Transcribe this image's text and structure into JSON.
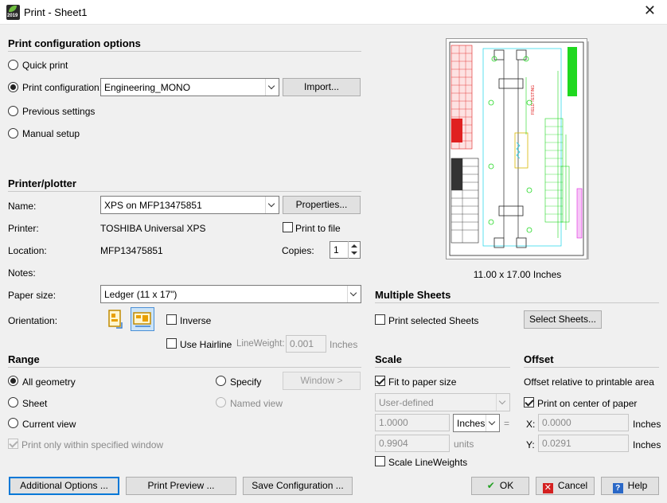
{
  "window": {
    "title": "Print - Sheet1",
    "app_icon_year": "2019"
  },
  "print_config": {
    "heading": "Print configuration options",
    "quick_print": "Quick print",
    "print_configuration": "Print configuration:",
    "config_value": "Engineering_MONO",
    "import_button": "Import...",
    "previous_settings": "Previous settings",
    "manual_setup": "Manual setup"
  },
  "printer": {
    "heading": "Printer/plotter",
    "name_label": "Name:",
    "name_value": "XPS on MFP13475851",
    "properties_button": "Properties...",
    "printer_label": "Printer:",
    "printer_value": "TOSHIBA Universal XPS",
    "print_to_file": "Print to file",
    "location_label": "Location:",
    "location_value": "MFP13475851",
    "copies_label": "Copies:",
    "copies_value": "1",
    "notes_label": "Notes:",
    "paper_size_label": "Paper size:",
    "paper_size_value": "Ledger (11 x 17\")",
    "orientation_label": "Orientation:",
    "inverse": "Inverse",
    "use_hairline": "Use Hairline",
    "lineweight_label": "LineWeight:",
    "lineweight_value": "0.001",
    "lineweight_unit": "Inches"
  },
  "preview": {
    "caption": "11.00 x 17.00 Inches"
  },
  "multiple_sheets": {
    "heading": "Multiple Sheets",
    "print_selected": "Print selected Sheets",
    "select_button": "Select Sheets..."
  },
  "range": {
    "heading": "Range",
    "all_geometry": "All geometry",
    "specify": "Specify",
    "window_button": "Window >",
    "sheet": "Sheet",
    "named_view": "Named view",
    "current_view": "Current view",
    "print_only_window": "Print only within specified window"
  },
  "scale": {
    "heading": "Scale",
    "fit_to_paper": "Fit to paper size",
    "scale_value": "User-defined",
    "value1": "1.0000",
    "unit_value": "Inches",
    "equals": "=",
    "value2": "0.9904",
    "units_label": "units",
    "scale_lineweights": "Scale LineWeights"
  },
  "offset": {
    "heading": "Offset",
    "description": "Offset relative to printable area",
    "center": "Print on center of paper",
    "x_label": "X:",
    "x_value": "0.0000",
    "x_unit": "Inches",
    "y_label": "Y:",
    "y_value": "0.0291",
    "y_unit": "Inches"
  },
  "footer": {
    "additional_options": "Additional Options ...",
    "print_preview": "Print Preview ...",
    "save_configuration": "Save Configuration ...",
    "ok": "OK",
    "cancel": "Cancel",
    "help": "Help"
  },
  "colors": {
    "accent": "#0078d7",
    "preview_red": "#e02020",
    "preview_green": "#1fd81f",
    "preview_cyan": "#19d4e8",
    "preview_magenta": "#e020e0"
  }
}
